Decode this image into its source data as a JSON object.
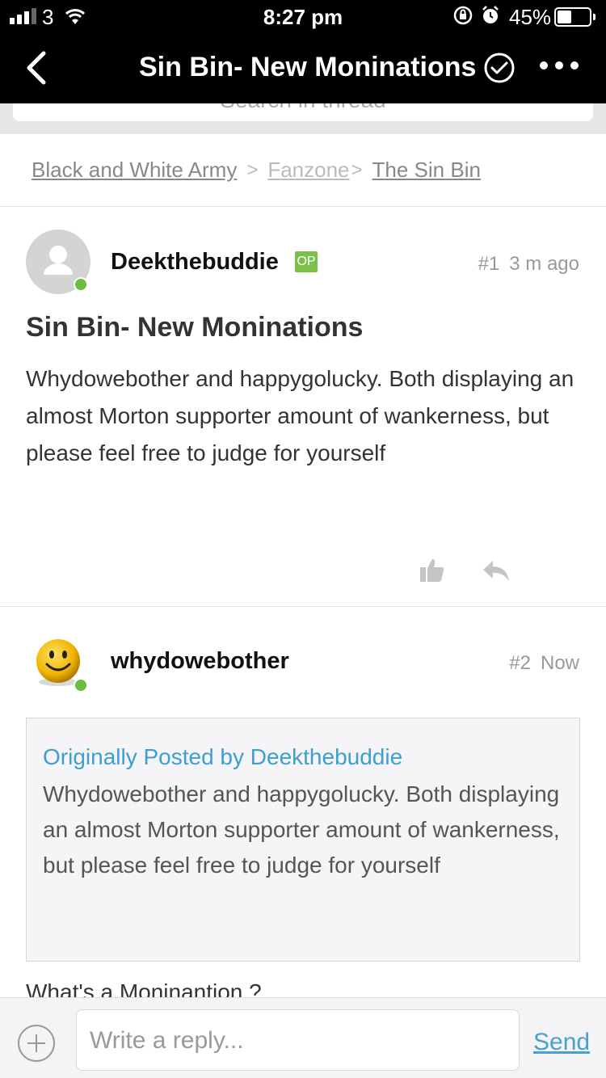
{
  "status_bar": {
    "carrier": "3",
    "time": "8:27 pm",
    "battery_percent": "45%",
    "battery_level": 0.45
  },
  "nav": {
    "title": "Sin Bin- New Moninations"
  },
  "search": {
    "placeholder": "Search in thread"
  },
  "breadcrumb": {
    "items": [
      "Black and White Army",
      "Fanzone",
      "The Sin Bin"
    ]
  },
  "posts": [
    {
      "username": "Deekthebuddie",
      "badge": "OP",
      "number": "#1",
      "time": "3 m ago",
      "title": "Sin Bin- New Moninations",
      "body": " Whydowebother and happygolucky.  Both displaying an almost Morton supporter amount of wankerness, but please feel free to judge for yourself"
    },
    {
      "username": "whydowebother",
      "number": "#2",
      "time": "Now",
      "quote_by": "Originally Posted by Deekthebuddie",
      "quote_text": " Whydowebother and happygolucky.  Both displaying an almost Morton supporter amount of wankerness, but please feel free to judge for yourself",
      "body": "What's a Moninantion ?"
    }
  ],
  "reply_bar": {
    "placeholder": "Write a reply...",
    "send_label": "Send"
  },
  "colors": {
    "header_bg": "#000000",
    "link_blue": "#3d9fd1",
    "online_green": "#6cbb45",
    "op_badge": "#7cc04a"
  }
}
